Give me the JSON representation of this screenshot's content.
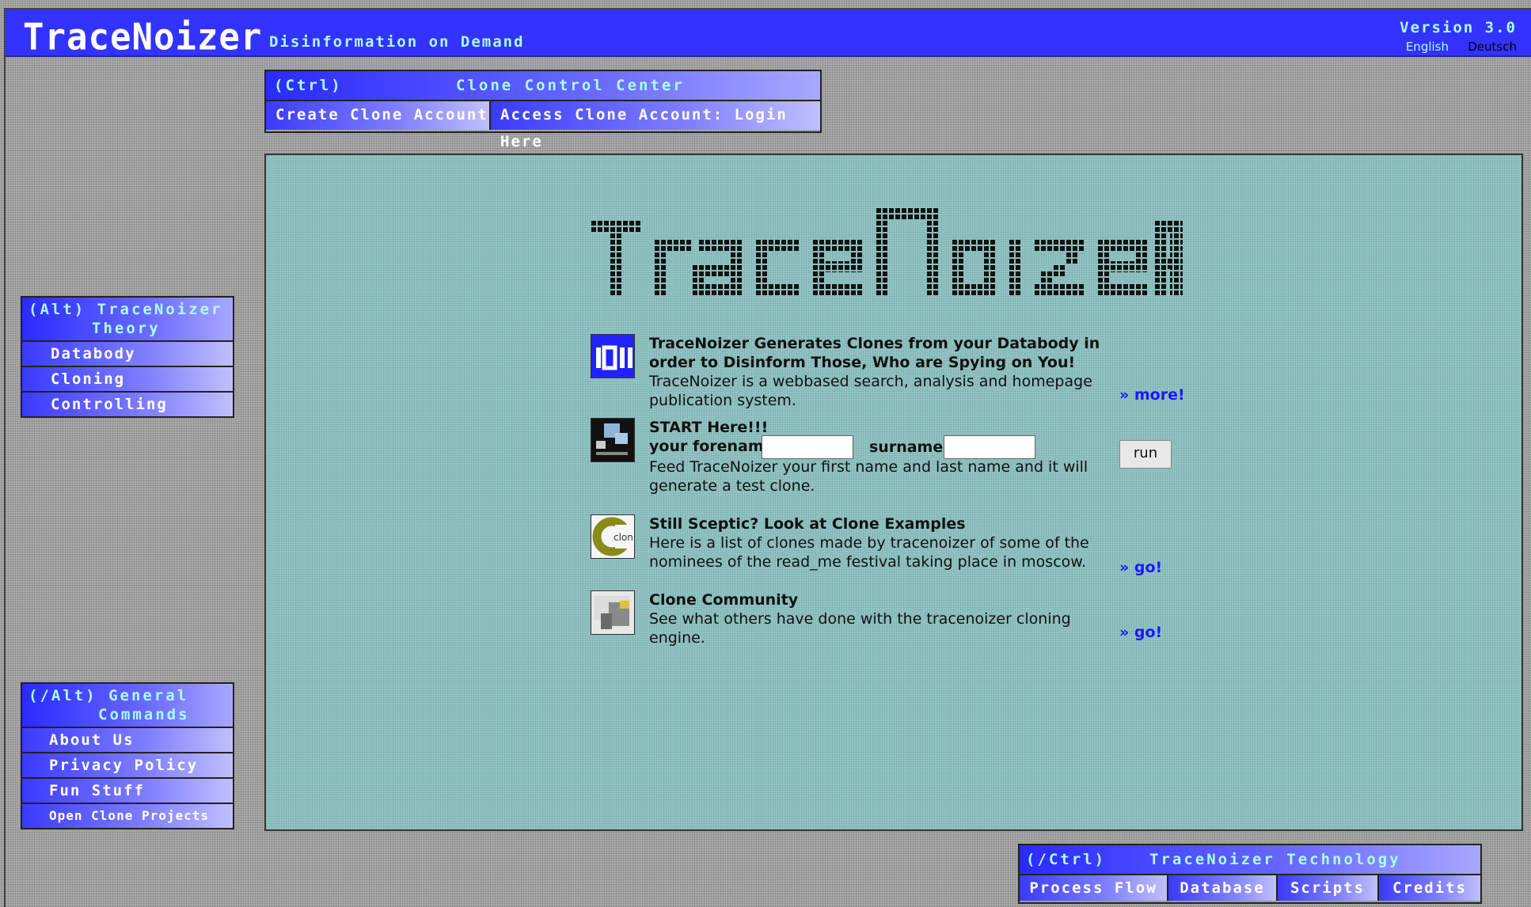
{
  "header": {
    "logo": "TraceNoizer",
    "tagline": "Disinformation on Demand",
    "version": "Version 3.0",
    "lang_en": "English",
    "lang_de": "Deutsch"
  },
  "ctrl_box": {
    "key": "(Ctrl)",
    "title": "Clone Control Center",
    "create": "Create Clone Account",
    "access": "Access Clone Account: Login Here"
  },
  "alt_box": {
    "key_line": "(Alt) TraceNoizer",
    "title_line": "Theory",
    "items": [
      "Databody",
      "Cloning",
      "Controlling"
    ]
  },
  "general_box": {
    "key_line": "(/Alt) General",
    "title_line": "Commands",
    "items": [
      "About Us",
      "Privacy Policy",
      "Fun Stuff",
      "Open Clone Projects"
    ]
  },
  "main": {
    "intro": {
      "bold": "TraceNoizer Generates Clones from your Databody in order to Disinform Those, Who are Spying on You!",
      "text": " TraceNoizer is a webbased search, analysis and homepage publication system.",
      "link": "» more!"
    },
    "start": {
      "title": "START Here!!!",
      "forename_label": "your forename",
      "surname_label": "surname:",
      "text": "Feed TraceNoizer your first name and last name and it will generate a test clone.",
      "run": "run"
    },
    "examples": {
      "title": "Still Sceptic? Look at Clone Examples",
      "text": "Here is a list of clones made by tracenoizer of some of the nominees of the read_me festival taking place in moscow.",
      "link": "» go!"
    },
    "community": {
      "title": "Clone Community",
      "text": "See what others have done with the tracenoizer cloning engine.",
      "link": "» go!"
    }
  },
  "tech_box": {
    "key": "(/Ctrl)",
    "title": "TraceNoizer Technology",
    "items": [
      "Process Flow",
      "Database",
      "Scripts",
      "Credits"
    ]
  },
  "colors": {
    "header_blue": "#3333ff",
    "cyan_text": "#aaffff",
    "panel_teal": "#93c3c3",
    "link_blue": "#1a1aff"
  }
}
